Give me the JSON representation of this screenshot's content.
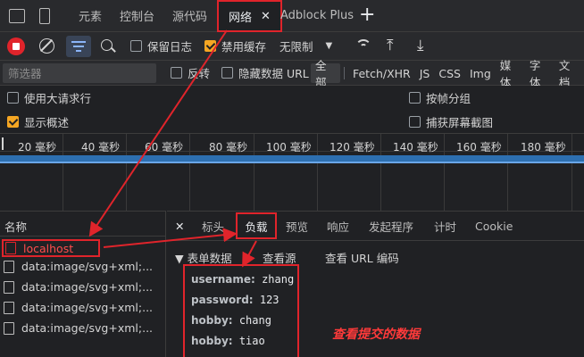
{
  "tabbar": {
    "tabs": [
      "元素",
      "控制台",
      "源代码",
      "网络",
      "Adblock Plus"
    ],
    "active_close": "✕",
    "add": "+"
  },
  "toolbar": {
    "preserve_log": "保留日志",
    "disable_cache": "禁用缓存",
    "throttle": "无限制",
    "dropdown_caret": "▼"
  },
  "filter": {
    "placeholder": "筛选器",
    "invert": "反转",
    "hide_data_urls": "隐藏数据 URL",
    "types": [
      "全部",
      "Fetch/XHR",
      "JS",
      "CSS",
      "Img",
      "媒体",
      "字体",
      "文档"
    ]
  },
  "options": {
    "big_rows": "使用大请求行",
    "overview": "显示概述",
    "group_by_frame": "按帧分组",
    "screenshots": "捕获屏幕截图"
  },
  "timeline": {
    "ticks": [
      "20 毫秒",
      "40 毫秒",
      "60 毫秒",
      "80 毫秒",
      "100 毫秒",
      "120 毫秒",
      "140 毫秒",
      "160 毫秒",
      "180 毫秒"
    ]
  },
  "requests": {
    "header": "名称",
    "items": [
      "localhost",
      "data:image/svg+xml;...",
      "data:image/svg+xml;...",
      "data:image/svg+xml;...",
      "data:image/svg+xml;..."
    ]
  },
  "detail": {
    "close": "✕",
    "tabs": [
      "标头",
      "负载",
      "预览",
      "响应",
      "发起程序",
      "计时",
      "Cookie"
    ],
    "section": "▼ 表单数据",
    "view_source": "查看源",
    "view_url_encoded": "查看 URL 编码",
    "form": [
      {
        "key": "username:",
        "value": "zhang"
      },
      {
        "key": "password:",
        "value": "123"
      },
      {
        "key": "hobby:",
        "value": "chang"
      },
      {
        "key": "hobby:",
        "value": "tiao"
      }
    ]
  },
  "annotation": "查看提交的数据",
  "colors": {
    "highlight": "#e0242b",
    "accent": "#f5a623",
    "timeline_bar": "#2d6fb0"
  }
}
